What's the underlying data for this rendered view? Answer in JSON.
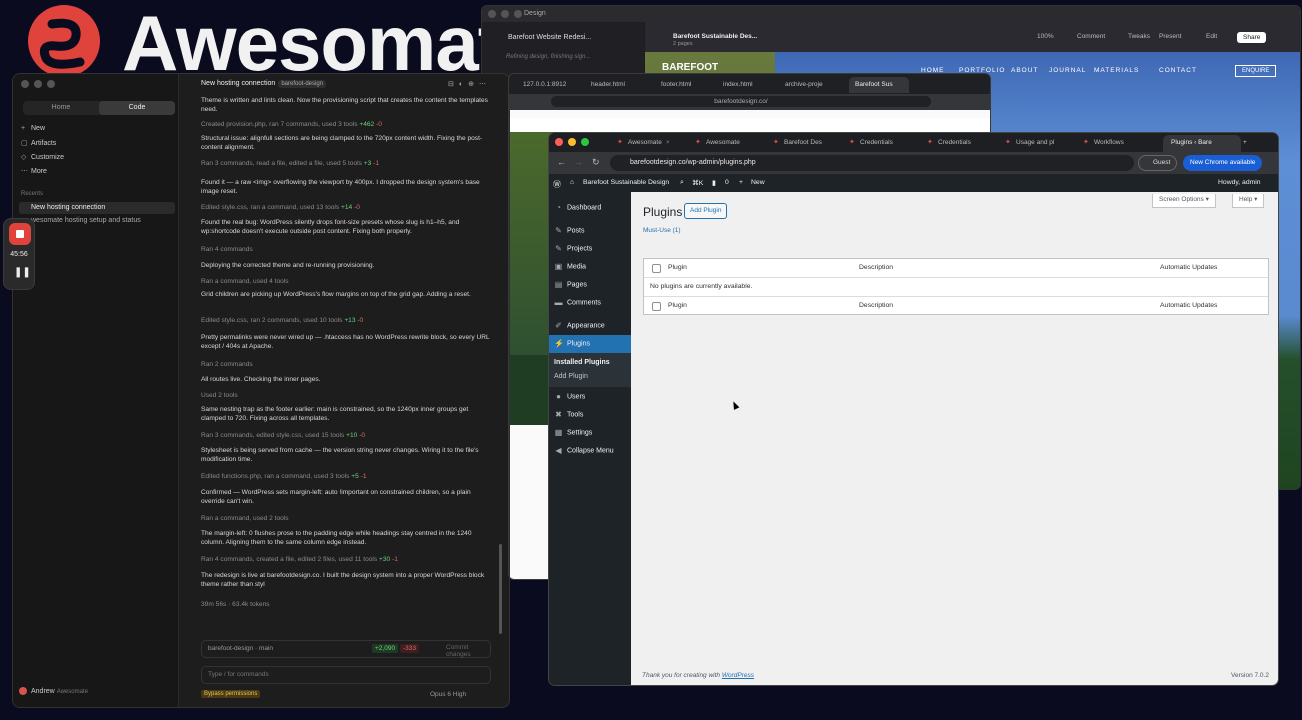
{
  "banner": {
    "brand": "Awesomat"
  },
  "recorder": {
    "time": "45:56"
  },
  "claude": {
    "sidebar": {
      "seg_home": "Home",
      "seg_code": "Code",
      "new": "New",
      "artifacts": "Artifacts",
      "customize": "Customize",
      "more": "More",
      "recents": "Recents",
      "recent1": "New hosting connection",
      "recent2": "wesomate hosting setup and status",
      "user": "Andrew",
      "user_sub": "Awesomate"
    },
    "title": "New hosting connection",
    "tag": "barefoot-design",
    "messages": [
      {
        "t": "Theme is written and lints clean. Now the provisioning script that creates the content the templates need."
      },
      {
        "t": "Created provision.php, ran 7 commands, used 3 tools",
        "add": "+462",
        "del": "-0",
        "muted": true
      },
      {
        "t": "Structural issue: alignfull sections are being clamped to the 720px content width. Fixing the post-content alignment."
      },
      {
        "t": "Ran 3 commands, read a file, edited a file, used 5 tools",
        "add": "+3",
        "del": "-1",
        "muted": true
      },
      {
        "t": "Found it — a raw <img> overflowing the viewport by 400px. I dropped the design system's base image reset."
      },
      {
        "t": "Edited style.css, ran a command, used 13 tools",
        "add": "+14",
        "del": "-0",
        "muted": true
      },
      {
        "t": "Found the real bug: WordPress silently drops font-size presets whose slug is h1–h5, and wp:shortcode doesn't execute outside post content. Fixing both properly."
      },
      {
        "t": "Ran 4 commands",
        "muted": true
      },
      {
        "t": "Deploying the corrected theme and re-running provisioning."
      },
      {
        "t": "Ran a command, used 4 tools",
        "muted": true
      },
      {
        "t": "Grid children are picking up WordPress's flow margins on top of the grid gap. Adding a reset."
      },
      {
        "t": "Edited style.css, ran 2 commands, used 10 tools",
        "add": "+13",
        "del": "-0",
        "muted": true
      },
      {
        "t": "Pretty permalinks were never wired up — .htaccess has no WordPress rewrite block, so every URL except / 404s at Apache."
      },
      {
        "t": "Ran 2 commands",
        "muted": true
      },
      {
        "t": "All routes live. Checking the inner pages."
      },
      {
        "t": "Used 2 tools",
        "muted": true
      },
      {
        "t": "Same nesting trap as the footer earlier: main is constrained, so the 1240px inner groups get clamped to 720. Fixing across all templates."
      },
      {
        "t": "Ran 3 commands, edited style.css, used 15 tools",
        "add": "+10",
        "del": "-0",
        "muted": true
      },
      {
        "t": "Stylesheet is being served from cache — the version string never changes. Wiring it to the file's modification time."
      },
      {
        "t": "Edited functions.php, ran a command, used 3 tools",
        "add": "+5",
        "del": "-1",
        "muted": true
      },
      {
        "t": "Confirmed — WordPress sets margin-left: auto !important on constrained children, so a plain override can't win."
      },
      {
        "t": "Ran a command, used 2 tools",
        "muted": true
      },
      {
        "t": "The margin-left: 0 flushes prose to the padding edge while headings stay centred in the 1240 column. Aligning them to the same column edge instead."
      },
      {
        "t": "Ran 4 commands, created a file, edited 2 files, used 11 tools",
        "add": "+30",
        "del": "-1",
        "muted": true
      },
      {
        "t": "The redesign is live at barefootdesign.co. I built the design system into a proper WordPress block theme rather than styl"
      },
      {
        "t": "39m 56s · 63.4k tokens",
        "muted": true
      }
    ],
    "branch": "barefoot-design · main",
    "stat_add": "+2,090",
    "stat_del": "-333",
    "commit": "Commit changes",
    "input_placeholder": "Type / for commands",
    "bypass": "Bypass permissions",
    "model": "Opus 6   High"
  },
  "design": {
    "app": "Design",
    "chat_title": "Barefoot Website Redesi...",
    "chat_status": "Refining design, finishing sign...",
    "file_title": "Barefoot Sustainable Des...",
    "file_sub": "2 pages",
    "zoom": "100%",
    "comment": "Comment",
    "tweaks": "Tweaks",
    "present": "Present",
    "edit": "Edit",
    "share": "Share",
    "nav": [
      "HOME",
      "PORTFOLIO",
      "ABOUT",
      "JOURNAL",
      "MATERIALS",
      "CONTACT"
    ],
    "enquire": "ENQUIRE",
    "logo": "BAREFOOT"
  },
  "chrome1": {
    "tabs": [
      "127.0.0.1:8912",
      "header.html",
      "footer.html",
      "index.html",
      "archive-proje",
      "Barefoot Sus"
    ],
    "url": "barefootdesign.co/"
  },
  "chrome2": {
    "tabs": [
      "Awesomate",
      "Awesomate",
      "Barefoot Des",
      "Credentials",
      "Credentials",
      "Usage and pl",
      "Workflows",
      "Plugins ‹ Bare"
    ],
    "url": "barefootdesign.co/wp-admin/plugins.php",
    "guest": "Guest",
    "update": "New Chrome available"
  },
  "wp": {
    "site": "Barefoot Sustainable Design",
    "shortcut": "⌘K",
    "comments": "0",
    "new": "New",
    "howdy": "Howdy, admin",
    "menu": [
      "Dashboard",
      "Posts",
      "Projects",
      "Media",
      "Pages",
      "Comments",
      "Appearance",
      "Plugins",
      "Users",
      "Tools",
      "Settings",
      "Collapse Menu"
    ],
    "sub_installed": "Installed Plugins",
    "sub_add": "Add Plugin",
    "title": "Plugins",
    "add_btn": "Add Plugin",
    "screen_options": "Screen Options ▾",
    "help": "Help ▾",
    "mustuse": "Must-Use (1)",
    "col_plugin": "Plugin",
    "col_desc": "Description",
    "col_auto": "Automatic Updates",
    "empty": "No plugins are currently available.",
    "footer_text": "Thank you for creating with ",
    "footer_link": "WordPress",
    "version": "Version 7.0.2"
  },
  "colors": {
    "wp_admin": "#1d2327",
    "wp_blue": "#2271b1",
    "brand_red": "#e0433b",
    "chrome_update": "#1a5ed6"
  }
}
